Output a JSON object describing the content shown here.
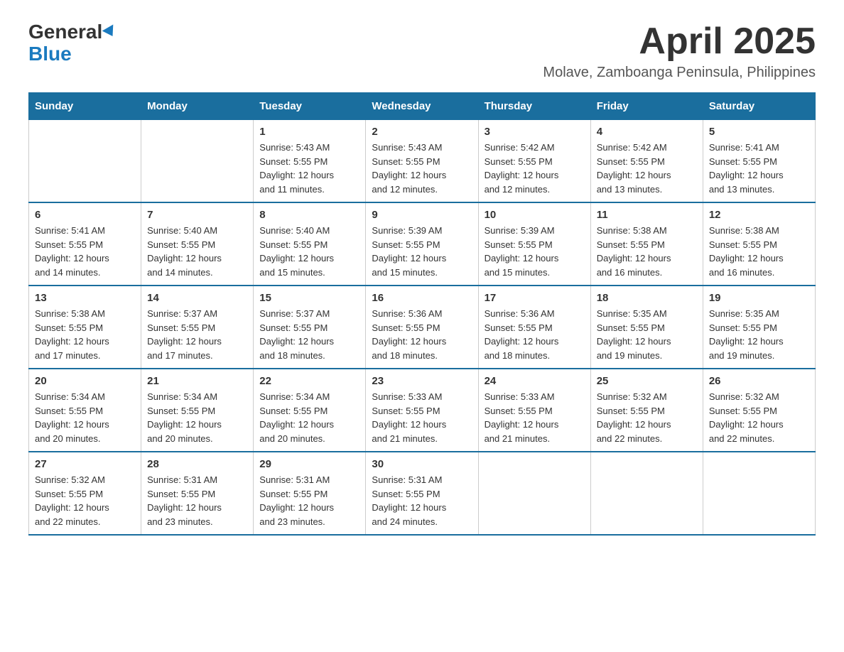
{
  "logo": {
    "general": "General",
    "blue": "Blue"
  },
  "title": "April 2025",
  "subtitle": "Molave, Zamboanga Peninsula, Philippines",
  "headers": [
    "Sunday",
    "Monday",
    "Tuesday",
    "Wednesday",
    "Thursday",
    "Friday",
    "Saturday"
  ],
  "weeks": [
    [
      {
        "day": "",
        "info": ""
      },
      {
        "day": "",
        "info": ""
      },
      {
        "day": "1",
        "info": "Sunrise: 5:43 AM\nSunset: 5:55 PM\nDaylight: 12 hours\nand 11 minutes."
      },
      {
        "day": "2",
        "info": "Sunrise: 5:43 AM\nSunset: 5:55 PM\nDaylight: 12 hours\nand 12 minutes."
      },
      {
        "day": "3",
        "info": "Sunrise: 5:42 AM\nSunset: 5:55 PM\nDaylight: 12 hours\nand 12 minutes."
      },
      {
        "day": "4",
        "info": "Sunrise: 5:42 AM\nSunset: 5:55 PM\nDaylight: 12 hours\nand 13 minutes."
      },
      {
        "day": "5",
        "info": "Sunrise: 5:41 AM\nSunset: 5:55 PM\nDaylight: 12 hours\nand 13 minutes."
      }
    ],
    [
      {
        "day": "6",
        "info": "Sunrise: 5:41 AM\nSunset: 5:55 PM\nDaylight: 12 hours\nand 14 minutes."
      },
      {
        "day": "7",
        "info": "Sunrise: 5:40 AM\nSunset: 5:55 PM\nDaylight: 12 hours\nand 14 minutes."
      },
      {
        "day": "8",
        "info": "Sunrise: 5:40 AM\nSunset: 5:55 PM\nDaylight: 12 hours\nand 15 minutes."
      },
      {
        "day": "9",
        "info": "Sunrise: 5:39 AM\nSunset: 5:55 PM\nDaylight: 12 hours\nand 15 minutes."
      },
      {
        "day": "10",
        "info": "Sunrise: 5:39 AM\nSunset: 5:55 PM\nDaylight: 12 hours\nand 15 minutes."
      },
      {
        "day": "11",
        "info": "Sunrise: 5:38 AM\nSunset: 5:55 PM\nDaylight: 12 hours\nand 16 minutes."
      },
      {
        "day": "12",
        "info": "Sunrise: 5:38 AM\nSunset: 5:55 PM\nDaylight: 12 hours\nand 16 minutes."
      }
    ],
    [
      {
        "day": "13",
        "info": "Sunrise: 5:38 AM\nSunset: 5:55 PM\nDaylight: 12 hours\nand 17 minutes."
      },
      {
        "day": "14",
        "info": "Sunrise: 5:37 AM\nSunset: 5:55 PM\nDaylight: 12 hours\nand 17 minutes."
      },
      {
        "day": "15",
        "info": "Sunrise: 5:37 AM\nSunset: 5:55 PM\nDaylight: 12 hours\nand 18 minutes."
      },
      {
        "day": "16",
        "info": "Sunrise: 5:36 AM\nSunset: 5:55 PM\nDaylight: 12 hours\nand 18 minutes."
      },
      {
        "day": "17",
        "info": "Sunrise: 5:36 AM\nSunset: 5:55 PM\nDaylight: 12 hours\nand 18 minutes."
      },
      {
        "day": "18",
        "info": "Sunrise: 5:35 AM\nSunset: 5:55 PM\nDaylight: 12 hours\nand 19 minutes."
      },
      {
        "day": "19",
        "info": "Sunrise: 5:35 AM\nSunset: 5:55 PM\nDaylight: 12 hours\nand 19 minutes."
      }
    ],
    [
      {
        "day": "20",
        "info": "Sunrise: 5:34 AM\nSunset: 5:55 PM\nDaylight: 12 hours\nand 20 minutes."
      },
      {
        "day": "21",
        "info": "Sunrise: 5:34 AM\nSunset: 5:55 PM\nDaylight: 12 hours\nand 20 minutes."
      },
      {
        "day": "22",
        "info": "Sunrise: 5:34 AM\nSunset: 5:55 PM\nDaylight: 12 hours\nand 20 minutes."
      },
      {
        "day": "23",
        "info": "Sunrise: 5:33 AM\nSunset: 5:55 PM\nDaylight: 12 hours\nand 21 minutes."
      },
      {
        "day": "24",
        "info": "Sunrise: 5:33 AM\nSunset: 5:55 PM\nDaylight: 12 hours\nand 21 minutes."
      },
      {
        "day": "25",
        "info": "Sunrise: 5:32 AM\nSunset: 5:55 PM\nDaylight: 12 hours\nand 22 minutes."
      },
      {
        "day": "26",
        "info": "Sunrise: 5:32 AM\nSunset: 5:55 PM\nDaylight: 12 hours\nand 22 minutes."
      }
    ],
    [
      {
        "day": "27",
        "info": "Sunrise: 5:32 AM\nSunset: 5:55 PM\nDaylight: 12 hours\nand 22 minutes."
      },
      {
        "day": "28",
        "info": "Sunrise: 5:31 AM\nSunset: 5:55 PM\nDaylight: 12 hours\nand 23 minutes."
      },
      {
        "day": "29",
        "info": "Sunrise: 5:31 AM\nSunset: 5:55 PM\nDaylight: 12 hours\nand 23 minutes."
      },
      {
        "day": "30",
        "info": "Sunrise: 5:31 AM\nSunset: 5:55 PM\nDaylight: 12 hours\nand 24 minutes."
      },
      {
        "day": "",
        "info": ""
      },
      {
        "day": "",
        "info": ""
      },
      {
        "day": "",
        "info": ""
      }
    ]
  ]
}
